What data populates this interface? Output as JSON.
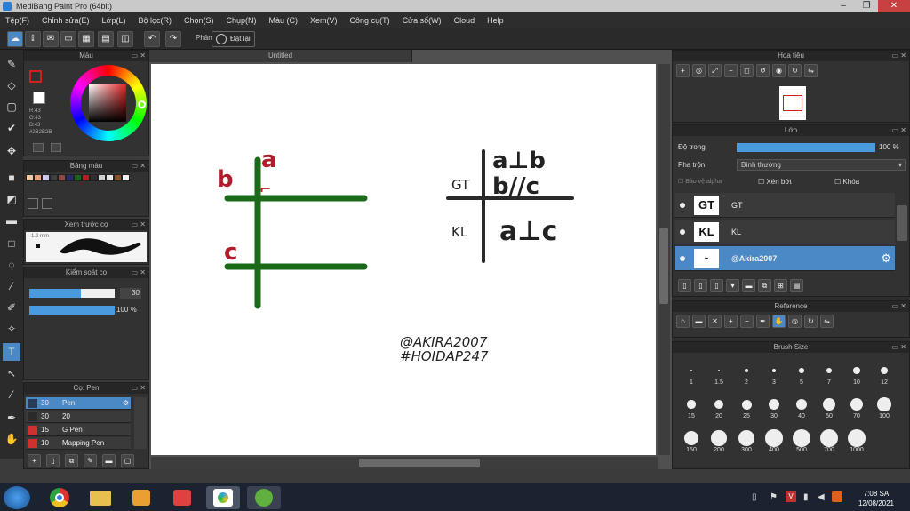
{
  "window": {
    "title": "MediBang Paint Pro (64bit)"
  },
  "menu": [
    "Tệp(F)",
    "Chỉnh sửa(E)",
    "Lớp(L)",
    "Bộ lọc(R)",
    "Chọn(S)",
    "Chụp(N)",
    "Màu (C)",
    "Xem(V)",
    "Công cụ(T)",
    "Cửa sổ(W)",
    "Cloud",
    "Help"
  ],
  "toolbar": {
    "undo_label": "Phản",
    "clear_label": "Đặt lại"
  },
  "color_panel": {
    "title": "Màu",
    "r": "R:43",
    "g": "G:43",
    "b": "B:43",
    "hex": "#2B2B2B"
  },
  "palette_panel": {
    "title": "Bảng màu",
    "colors": [
      "#f0c8a8",
      "#e8a080",
      "#c8c8e8",
      "#404040",
      "#8a4a4a",
      "#2a2a6a",
      "#206020",
      "#b02020",
      "#303030",
      "#d0d0d0",
      "#e8e8e8",
      "#8a5030",
      "#f0f0f0"
    ]
  },
  "brush_preview_panel": {
    "title": "Xem trước cọ",
    "size_text": "1.2 mm"
  },
  "brush_control_panel": {
    "title": "Kiểm soát cọ",
    "size_value": "30",
    "opacity_value": "100 %",
    "size_fraction": 0.6,
    "opacity_fraction": 1.0
  },
  "pen_panel": {
    "title": "Cọ: Pen",
    "pens": [
      {
        "size": "30",
        "name": "Pen",
        "color": "#2a3a5a"
      },
      {
        "size": "30",
        "name": "20",
        "color": "#2a2a2a"
      },
      {
        "size": "15",
        "name": "G Pen",
        "color": "#d03030"
      },
      {
        "size": "10",
        "name": "Mapping Pen",
        "color": "#d03030"
      }
    ]
  },
  "canvas": {
    "tab_title": "Untitled",
    "left_figure": {
      "a": "a",
      "b": "b",
      "c": "c",
      "mark": "⌐"
    },
    "right_figure": {
      "gt": "GT",
      "kl": "KL",
      "premise1": "a⊥b",
      "premise2": "b//c",
      "conclusion": "a⊥c"
    },
    "watermark1": "@AKIRA2007",
    "watermark2": "#HOIDAP247"
  },
  "navigator_panel": {
    "title": "Hoa tiêu"
  },
  "layer_panel": {
    "title": "Lớp",
    "opacity_label": "Độ trong",
    "opacity_value": "100 %",
    "blend_label": "Pha trộn",
    "blend_value": "Bình thường",
    "protect_alpha": "Bảo vệ alpha",
    "clipping": "Xén bớt",
    "lock": "Khóa",
    "layers": [
      {
        "name": "GT",
        "thumb": "GT"
      },
      {
        "name": "KL",
        "thumb": "KL"
      },
      {
        "name": "@Akira2007",
        "thumb": "~"
      }
    ]
  },
  "reference_panel": {
    "title": "Reference"
  },
  "brush_size_panel": {
    "title": "Brush Size",
    "sizes": [
      "1",
      "1.5",
      "2",
      "3",
      "5",
      "7",
      "10",
      "12",
      "15",
      "20",
      "25",
      "30",
      "40",
      "50",
      "70",
      "100",
      "150",
      "200",
      "300",
      "400",
      "500",
      "700",
      "1000"
    ]
  },
  "taskbar": {
    "time": "7:08 SA",
    "date": "12/08/2021"
  }
}
